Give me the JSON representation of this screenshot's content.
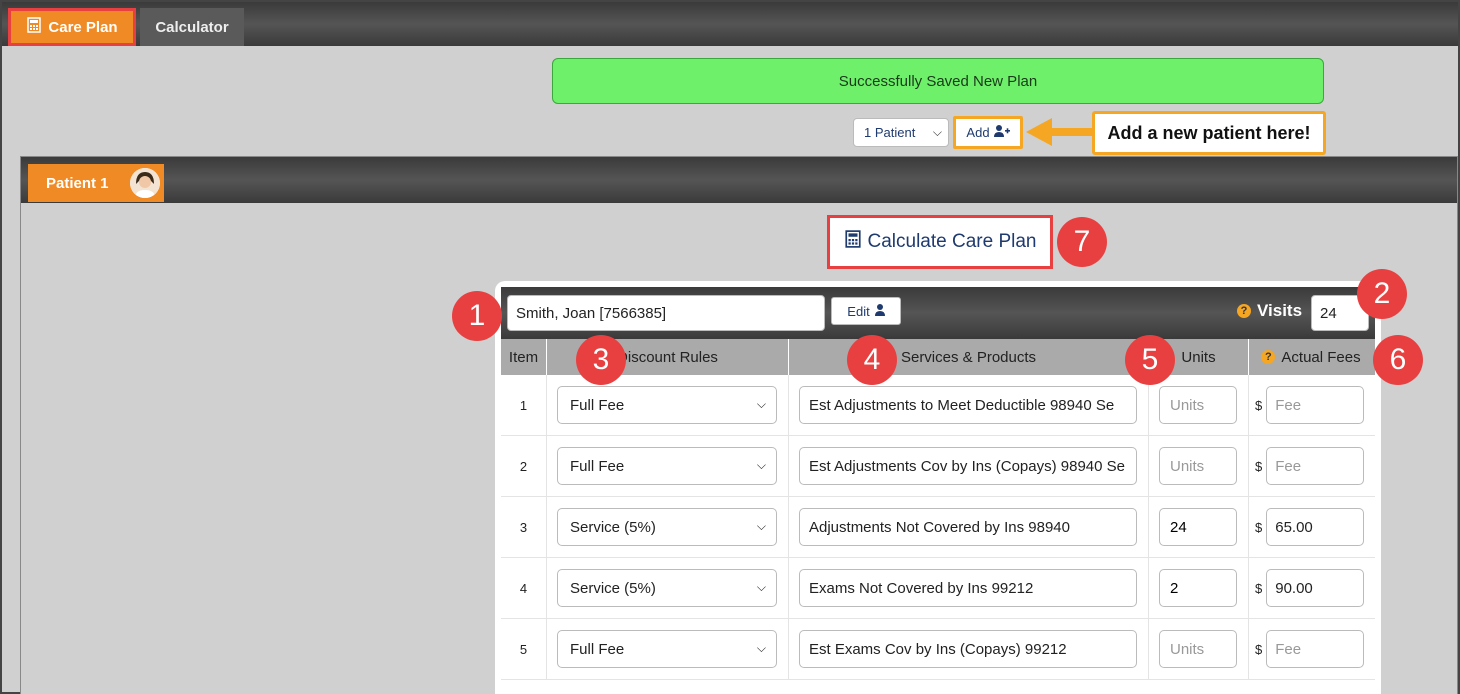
{
  "top_tabs": {
    "care_plan": "Care Plan",
    "calculator": "Calculator"
  },
  "banner": "Successfully Saved New Plan",
  "patient_select": {
    "value": "1 Patient"
  },
  "add_button": "Add",
  "callout": "Add a new patient here!",
  "patient_tab": "Patient 1",
  "calculate_button": "Calculate Care Plan",
  "patient_name": "Smith, Joan [7566385]",
  "edit_button": "Edit",
  "visits": {
    "label": "Visits",
    "value": "24"
  },
  "markers": [
    "1",
    "2",
    "3",
    "4",
    "5",
    "6",
    "7"
  ],
  "table": {
    "headers": [
      "Item",
      "Discount Rules",
      "Services & Products",
      "Units",
      "Actual Fees"
    ],
    "rows": [
      {
        "item": "1",
        "rule": "Full Fee",
        "service": "Est Adjustments to Meet Deductible 98940 Se",
        "units": "",
        "fee": ""
      },
      {
        "item": "2",
        "rule": "Full Fee",
        "service": "Est Adjustments Cov by Ins (Copays) 98940 Se",
        "units": "",
        "fee": ""
      },
      {
        "item": "3",
        "rule": "Service (5%)",
        "service": "Adjustments Not Covered by Ins 98940",
        "units": "24",
        "fee": "65.00"
      },
      {
        "item": "4",
        "rule": "Service (5%)",
        "service": "Exams Not Covered by Ins 99212",
        "units": "2",
        "fee": "90.00"
      },
      {
        "item": "5",
        "rule": "Full Fee",
        "service": "Est Exams Cov by Ins (Copays) 99212",
        "units": "",
        "fee": ""
      }
    ],
    "units_placeholder": "Units",
    "fee_placeholder": "Fee",
    "currency": "$"
  },
  "colors": {
    "accent": "#f08a24",
    "highlight": "#e84040",
    "callout": "#f5a623",
    "success": "#6ef06a"
  }
}
